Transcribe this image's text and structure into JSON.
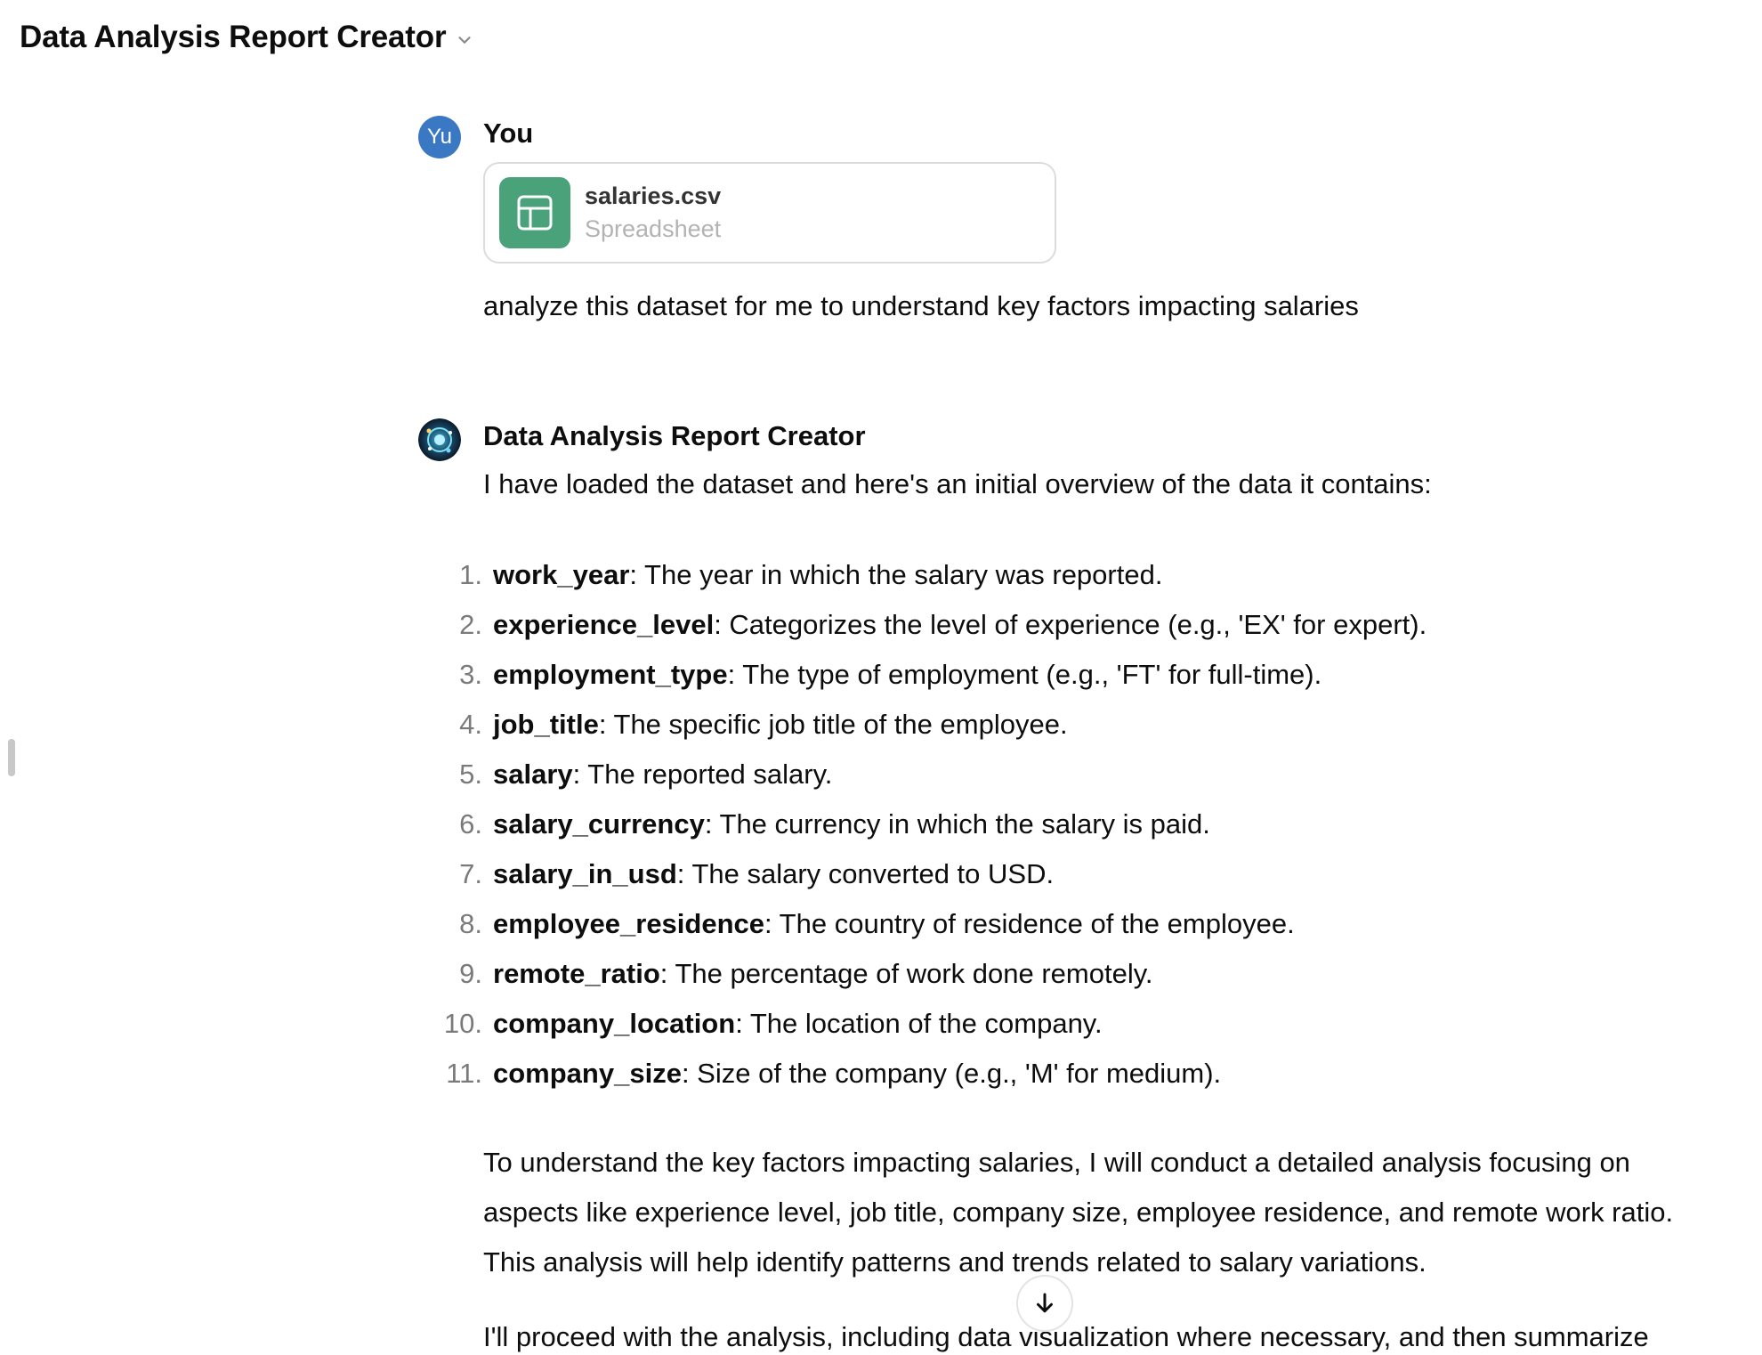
{
  "header": {
    "title": "Data Analysis Report Creator",
    "dropdown_icon": "chevron-down-icon"
  },
  "user_turn": {
    "avatar_initials": "Yu",
    "author": "You",
    "attachment": {
      "file_name": "salaries.csv",
      "file_type": "Spreadsheet",
      "icon": "table-icon"
    },
    "message": "analyze this dataset for me to understand key factors impacting salaries"
  },
  "assistant_turn": {
    "author": "Data Analysis Report Creator",
    "intro": "I have loaded the dataset and here's an initial overview of the data it contains:",
    "fields": [
      {
        "num": "1.",
        "name": "work_year",
        "desc": ": The year in which the salary was reported."
      },
      {
        "num": "2.",
        "name": "experience_level",
        "desc": ": Categorizes the level of experience (e.g., 'EX' for expert)."
      },
      {
        "num": "3.",
        "name": "employment_type",
        "desc": ": The type of employment (e.g., 'FT' for full-time)."
      },
      {
        "num": "4.",
        "name": "job_title",
        "desc": ": The specific job title of the employee."
      },
      {
        "num": "5.",
        "name": "salary",
        "desc": ": The reported salary."
      },
      {
        "num": "6.",
        "name": "salary_currency",
        "desc": ": The currency in which the salary is paid."
      },
      {
        "num": "7.",
        "name": "salary_in_usd",
        "desc": ": The salary converted to USD."
      },
      {
        "num": "8.",
        "name": "employee_residence",
        "desc": ": The country of residence of the employee."
      },
      {
        "num": "9.",
        "name": "remote_ratio",
        "desc": ": The percentage of work done remotely."
      },
      {
        "num": "10.",
        "name": "company_location",
        "desc": ": The location of the company."
      },
      {
        "num": "11.",
        "name": "company_size",
        "desc": ": Size of the company (e.g., 'M' for medium)."
      }
    ],
    "paragraph_1": "To understand the key factors impacting salaries, I will conduct a detailed analysis focusing on aspects like experience level, job title, company size, employee residence, and remote work ratio. This analysis will help identify patterns and trends related to salary variations.",
    "paragraph_2": "I'll proceed with the analysis, including data visualization where necessary, and then summarize"
  },
  "scroll_button": {
    "icon": "arrow-down-icon"
  }
}
